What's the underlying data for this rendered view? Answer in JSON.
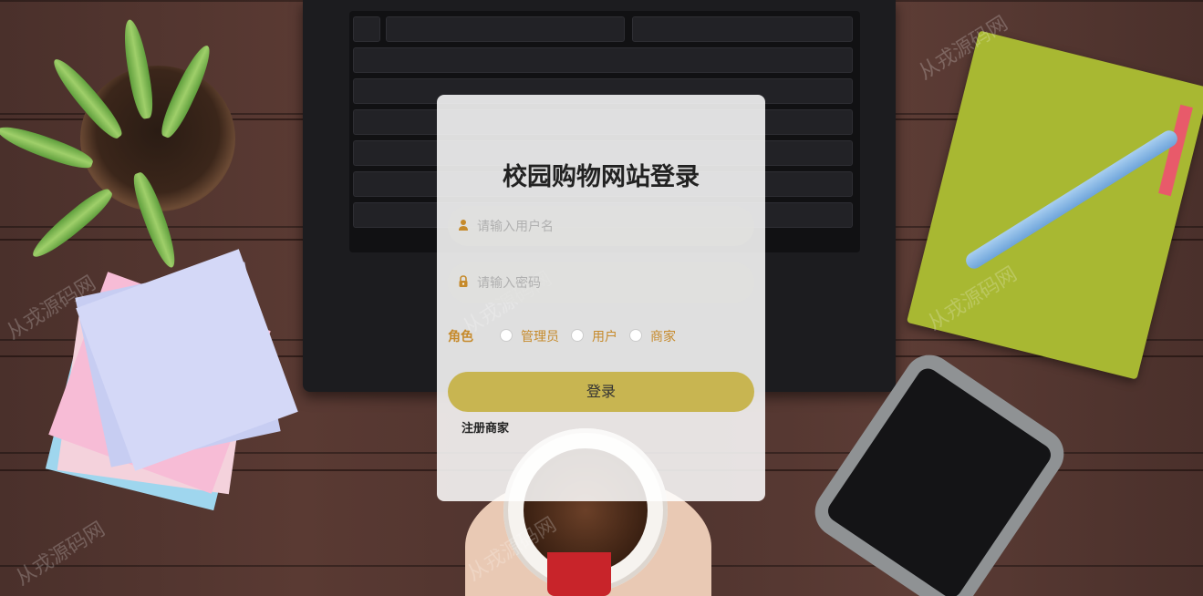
{
  "login": {
    "title": "校园购物网站登录",
    "username_placeholder": "请输入用户名",
    "password_placeholder": "请输入密码",
    "role_label": "角色",
    "roles": [
      "管理员",
      "用户",
      "商家"
    ],
    "login_button": "登录",
    "register_link": "注册商家"
  },
  "watermark": "从戎源码网",
  "icons": {
    "username": "user-icon",
    "password": "lock-icon"
  },
  "colors": {
    "accent_gold": "#c8b551",
    "role_text": "#c68a2b",
    "card_bg": "#ffffff"
  }
}
